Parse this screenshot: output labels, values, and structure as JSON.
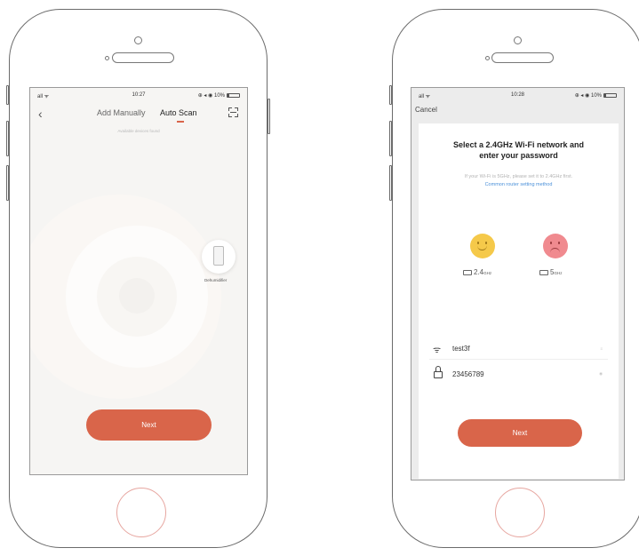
{
  "left_phone": {
    "status": {
      "signal": "all ᯤ",
      "time": "10:27",
      "right": "⊕ ◂ ◉ 10%"
    },
    "nav": {
      "back_icon": "chevron-left-icon",
      "tab_manual": "Add Manually",
      "tab_auto": "Auto Scan",
      "scan_icon": "scan-icon"
    },
    "hint": "Available devices found",
    "device_label": "Dehumidifier",
    "next_label": "Next"
  },
  "right_phone": {
    "status": {
      "signal": "all ᯤ",
      "time": "10:28",
      "right": "⊕ ◂ ◉ 10%"
    },
    "cancel_label": "Cancel",
    "title_line1": "Select a 2.4GHz Wi-Fi network and",
    "title_line2": "enter your password",
    "subtitle": "If your Wi-Fi is 5GHz, please set it to 2.4GHz first.",
    "link": "Common router setting method",
    "band_good": {
      "value": "2.4",
      "unit": "GHz"
    },
    "band_bad": {
      "value": "5",
      "unit": "GHz"
    },
    "wifi_ssid": "test3f",
    "wifi_tail": "≡",
    "password": "23456789",
    "password_tail": "◉",
    "next_label": "Next"
  },
  "colors": {
    "accent": "#d9654a",
    "link": "#4a90d9",
    "happy_face": "#f5c94a",
    "sad_face": "#f08a8f"
  }
}
